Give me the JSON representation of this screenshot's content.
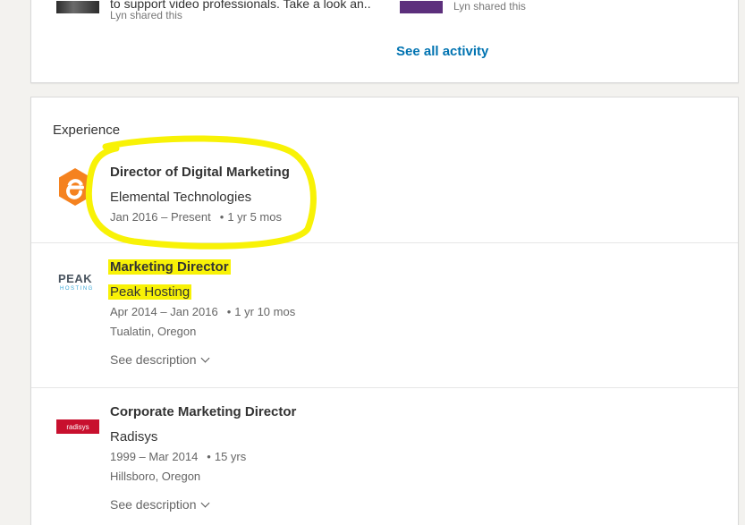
{
  "activity": {
    "items": [
      {
        "title": "to support video professionals. Take a look an..",
        "shared_by": "Lyn shared this"
      },
      {
        "title": "",
        "shared_by": "Lyn shared this"
      }
    ],
    "see_all_label": "See all activity"
  },
  "experience": {
    "header": "Experience",
    "positions": [
      {
        "title": "Director of Digital Marketing",
        "company": "Elemental Technologies",
        "dates": "Jan 2016 – Present",
        "duration": "1 yr 5 mos",
        "location": "",
        "see_description": ""
      },
      {
        "title": "Marketing Director",
        "company": "Peak Hosting",
        "dates": "Apr 2014 – Jan 2016",
        "duration": "1 yr 10 mos",
        "location": "Tualatin, Oregon",
        "see_description": "See description"
      },
      {
        "title": "Corporate Marketing Director",
        "company": "Radisys",
        "dates": "1999 – Mar 2014",
        "duration": "15 yrs",
        "location": "Hillsboro, Oregon",
        "see_description": "See description"
      }
    ]
  },
  "logos": {
    "peak_word": "PEAK",
    "peak_sub": "HOSTING",
    "radisys_word": "radisys"
  },
  "colors": {
    "link": "#0073b1",
    "highlight": "#f8f206",
    "elemental_orange": "#f5821f",
    "radisys_red": "#c8102e"
  }
}
